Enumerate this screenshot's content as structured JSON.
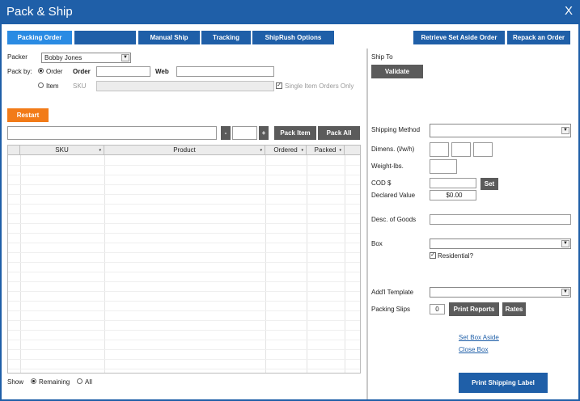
{
  "window": {
    "title": "Pack & Ship",
    "close_glyph": "X"
  },
  "tabs": [
    {
      "label": "Packing Order"
    },
    {
      "label": ""
    },
    {
      "label": "Manual Ship"
    },
    {
      "label": "Tracking"
    },
    {
      "label": "ShipRush Options"
    }
  ],
  "top_buttons": {
    "retrieve": "Retrieve Set Aside Order",
    "repack": "Repack an Order"
  },
  "packer": {
    "label": "Packer",
    "value": "Bobby Jones"
  },
  "pack_by": {
    "label": "Pack by:",
    "order_option": "Order",
    "order_label": "Order",
    "order_value": "",
    "web_label": "Web",
    "web_value": "",
    "item_option": "Item",
    "sku_label": "SKU",
    "sku_value": "",
    "single_item_label": "Single Item Orders Only"
  },
  "restart_button": "Restart",
  "scan": {
    "value": "",
    "qty_value": "",
    "minus": "-",
    "plus": "+",
    "pack_item": "Pack Item",
    "pack_all": "Pack All"
  },
  "grid": {
    "columns": [
      "SKU",
      "Product",
      "Ordered",
      "Packed"
    ],
    "sort_glyph": "▾"
  },
  "show": {
    "label": "Show",
    "remaining": "Remaining",
    "all": "All"
  },
  "ship_to": {
    "label": "Ship To",
    "validate": "Validate"
  },
  "shipping_method": {
    "label": "Shipping Method",
    "value": ""
  },
  "dimens": {
    "label": "Dimens. (l/w/h)",
    "l": "",
    "w": "",
    "h": ""
  },
  "weight": {
    "label": "Weight-lbs.",
    "value": ""
  },
  "cod": {
    "label": "COD $",
    "value": "",
    "set_button": "Set"
  },
  "declared_value": {
    "label": "Declared Value",
    "value": "$0.00"
  },
  "desc_of_goods": {
    "label": "Desc. of Goods",
    "value": ""
  },
  "box": {
    "label": "Box",
    "value": "",
    "residential_label": "Residential?"
  },
  "addl_template": {
    "label": "Add'l Template",
    "value": ""
  },
  "packing_slips": {
    "label": "Packing Slips",
    "value": "0",
    "print_reports": "Print Reports",
    "rates": "Rates"
  },
  "links": {
    "set_box_aside": "Set Box Aside",
    "close_box": "Close Box"
  },
  "print_label_button": "Print Shipping Label",
  "colors": {
    "window_blue": "#1f5fa8",
    "active_tab": "#2a8be3",
    "accent_orange": "#f27b18",
    "button_dark": "#5b5b5b"
  }
}
